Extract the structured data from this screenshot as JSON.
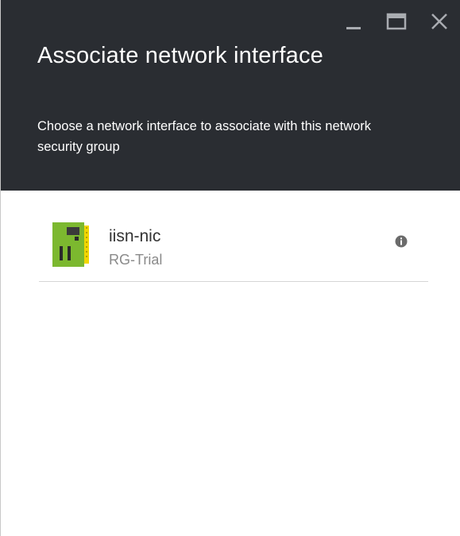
{
  "header": {
    "title": "Associate network interface",
    "subtitle": "Choose a network interface to associate with this network security group"
  },
  "window_controls": [
    "minimize-icon",
    "maximize-icon",
    "close-icon"
  ],
  "network_interfaces": [
    {
      "name": "iisn-nic",
      "resource_group": "RG-Trial",
      "icon": "network-interface-card-icon"
    }
  ],
  "colors": {
    "header_bg": "#2a2d32",
    "header_text": "#ffffff",
    "nic_icon_green": "#7cb82f",
    "nic_icon_yellow": "#f2d600",
    "nic_name": "#333333",
    "nic_group": "#8a8a8a"
  }
}
